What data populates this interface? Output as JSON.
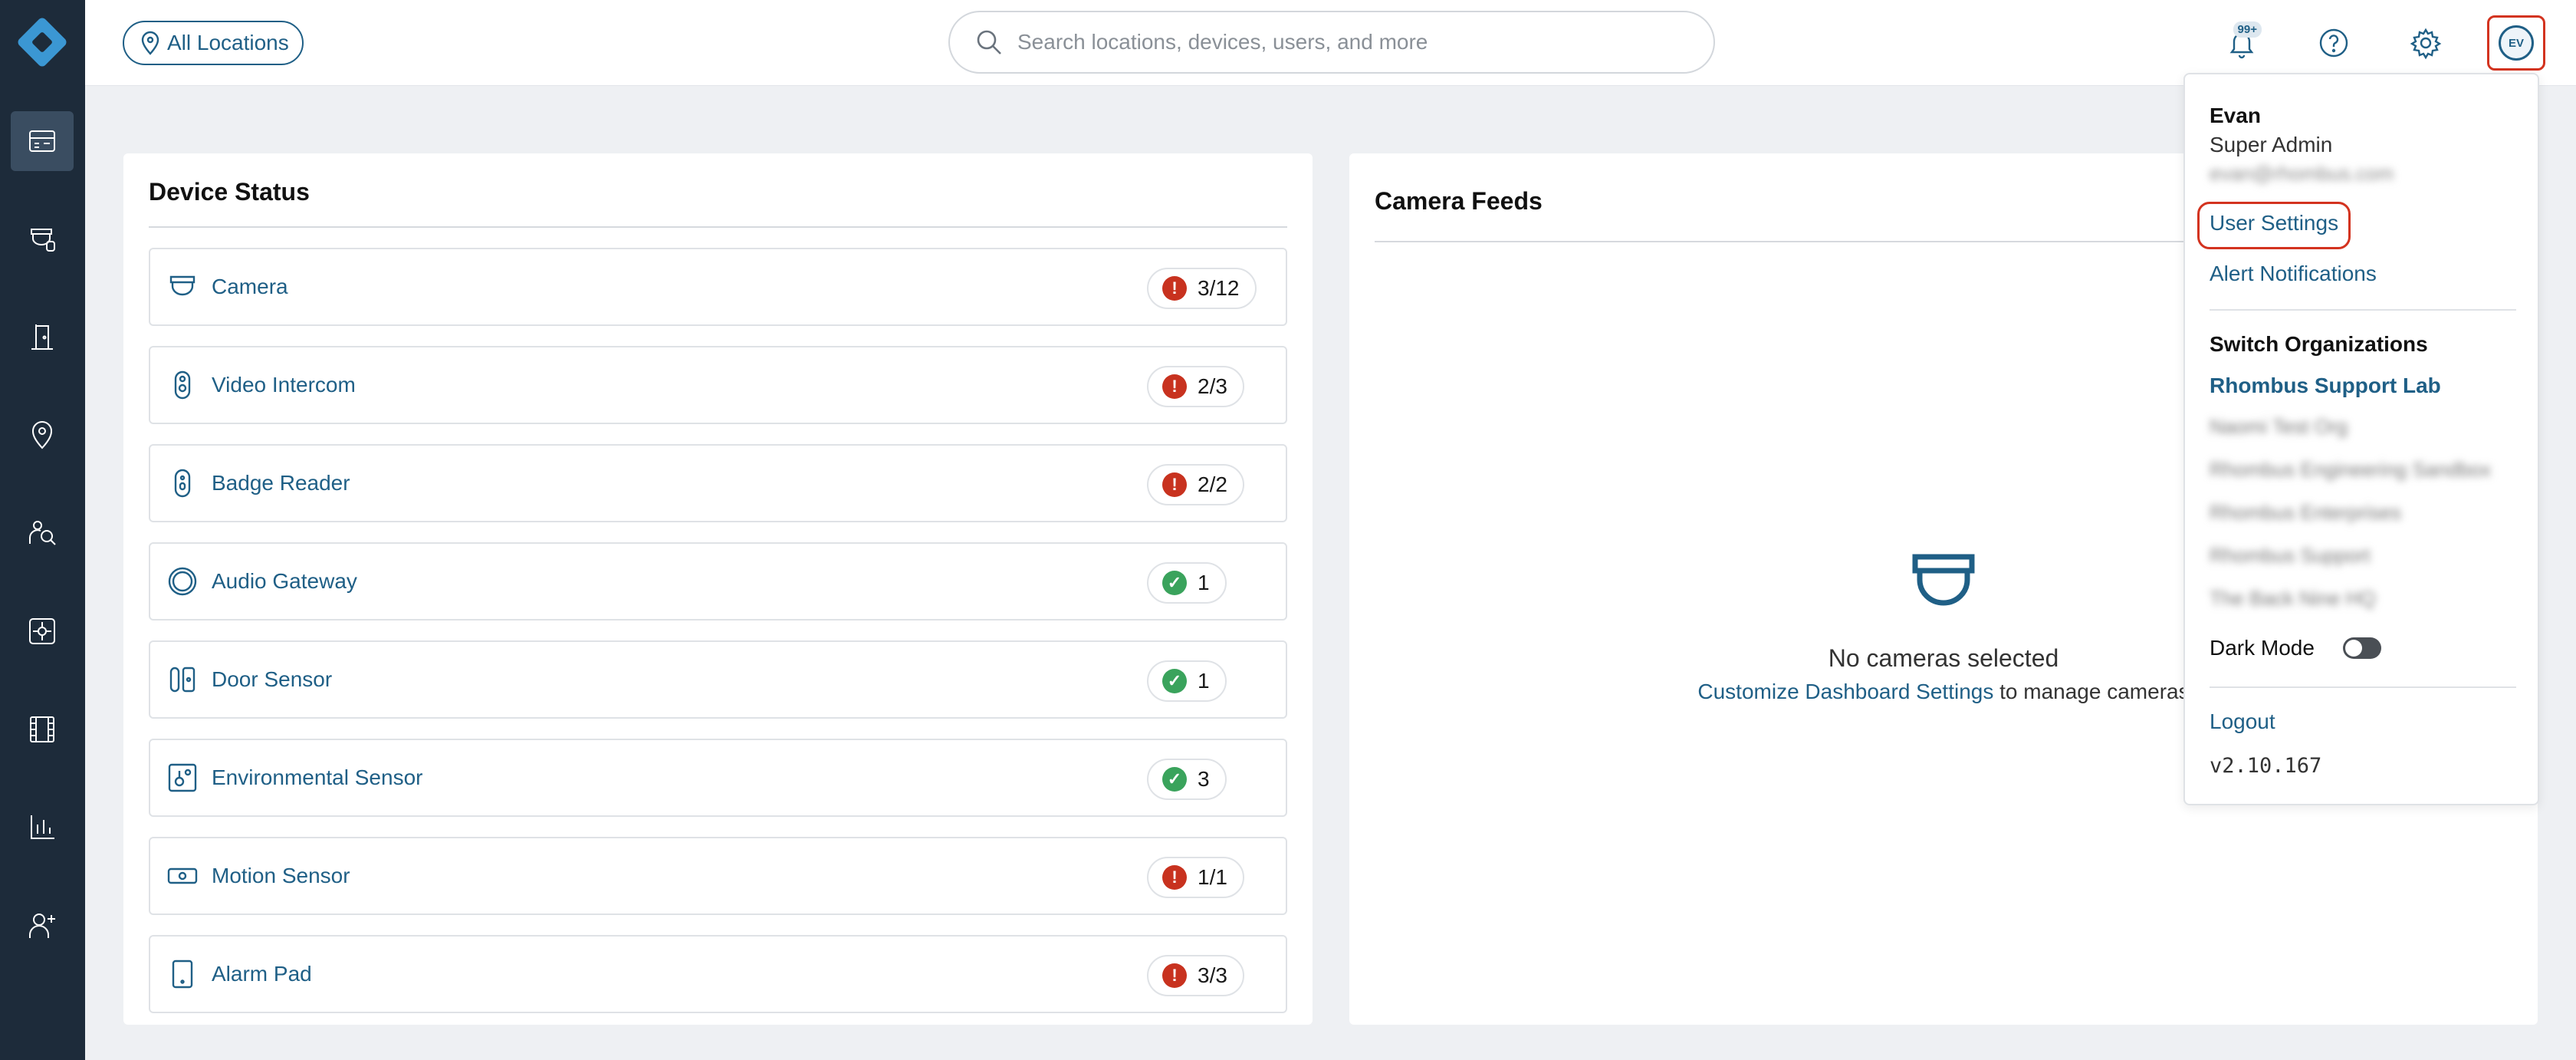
{
  "sidebar": {
    "items": [
      {
        "icon": "dashboard-icon",
        "active": true
      },
      {
        "icon": "camera-device-icon"
      },
      {
        "icon": "door-access-icon"
      },
      {
        "icon": "location-pin-icon"
      },
      {
        "icon": "people-search-icon"
      },
      {
        "icon": "view-grid-icon"
      },
      {
        "icon": "film-icon"
      },
      {
        "icon": "bar-chart-icon"
      },
      {
        "icon": "add-user-icon"
      }
    ]
  },
  "topbar": {
    "location_label": "All Locations",
    "search_placeholder": "Search locations, devices, users, and more",
    "notification_badge": "99+",
    "avatar_initials": "EV"
  },
  "device_status": {
    "title": "Device Status",
    "rows": [
      {
        "name": "Camera",
        "icon": "camera-icon",
        "status": "error",
        "count": "3/12"
      },
      {
        "name": "Video Intercom",
        "icon": "video-intercom-icon",
        "status": "error",
        "count": "2/3"
      },
      {
        "name": "Badge Reader",
        "icon": "badge-reader-icon",
        "status": "error",
        "count": "2/2"
      },
      {
        "name": "Audio Gateway",
        "icon": "audio-gateway-icon",
        "status": "ok",
        "count": "1"
      },
      {
        "name": "Door Sensor",
        "icon": "door-sensor-icon",
        "status": "ok",
        "count": "1"
      },
      {
        "name": "Environmental Sensor",
        "icon": "environmental-sensor-icon",
        "status": "ok",
        "count": "3"
      },
      {
        "name": "Motion Sensor",
        "icon": "motion-sensor-icon",
        "status": "error",
        "count": "1/1"
      },
      {
        "name": "Alarm Pad",
        "icon": "alarm-pad-icon",
        "status": "error",
        "count": "3/3"
      }
    ]
  },
  "camera_feeds": {
    "title": "Camera Feeds",
    "empty_message": "No cameras selected",
    "link_text": "Customize Dashboard Settings",
    "link_suffix": " to manage cameras"
  },
  "user_menu": {
    "name": "Evan",
    "role": "Super Admin",
    "email": "evan@rhombus.com",
    "user_settings": "User Settings",
    "alert_notifications": "Alert Notifications",
    "switch_orgs_heading": "Switch Organizations",
    "active_org": "Rhombus Support Lab",
    "other_orgs": [
      "Naomi Test Org",
      "Rhombus Engineering Sandbox",
      "Rhombus Enterprises",
      "Rhombus Support",
      "The Back Nine HQ"
    ],
    "dark_mode_label": "Dark Mode",
    "dark_mode_on": false,
    "logout": "Logout",
    "version": "v2.10.167"
  },
  "colors": {
    "sidebar_bg": "#1d2b3a",
    "accent": "#1f5f86",
    "error": "#c8321f",
    "ok": "#3aa35c",
    "highlight": "#d3331f"
  }
}
